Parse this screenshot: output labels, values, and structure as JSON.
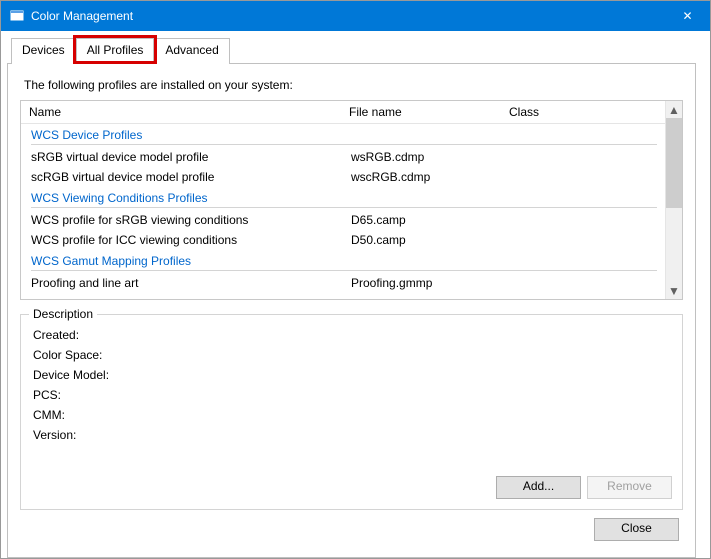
{
  "window": {
    "title": "Color Management",
    "close_glyph": "✕"
  },
  "tabs": {
    "devices": "Devices",
    "all_profiles": "All Profiles",
    "advanced": "Advanced",
    "active": "all_profiles"
  },
  "intro": "The following profiles are installed on your system:",
  "columns": {
    "name": "Name",
    "file": "File name",
    "class": "Class"
  },
  "groups": [
    {
      "header": "WCS Device Profiles",
      "rows": [
        {
          "name": "sRGB virtual device model profile",
          "file": "wsRGB.cdmp",
          "class": ""
        },
        {
          "name": "scRGB virtual device model profile",
          "file": "wscRGB.cdmp",
          "class": ""
        }
      ]
    },
    {
      "header": "WCS Viewing Conditions Profiles",
      "rows": [
        {
          "name": "WCS profile for sRGB viewing conditions",
          "file": "D65.camp",
          "class": ""
        },
        {
          "name": "WCS profile for ICC viewing conditions",
          "file": "D50.camp",
          "class": ""
        }
      ]
    },
    {
      "header": "WCS Gamut Mapping Profiles",
      "rows": [
        {
          "name": "Proofing and line art",
          "file": "Proofing.gmmp",
          "class": ""
        }
      ]
    }
  ],
  "description": {
    "legend": "Description",
    "created_label": "Created:",
    "colorspace_label": "Color Space:",
    "devicemodel_label": "Device Model:",
    "pcs_label": "PCS:",
    "cmm_label": "CMM:",
    "version_label": "Version:"
  },
  "buttons": {
    "add": "Add...",
    "remove": "Remove",
    "close": "Close"
  },
  "scroll_glyphs": {
    "up": "▲",
    "down": "▼"
  }
}
